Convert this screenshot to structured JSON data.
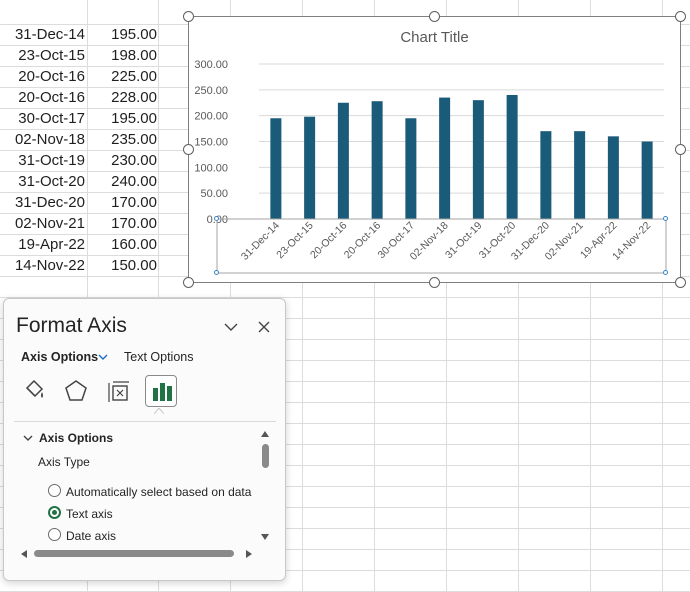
{
  "table": {
    "rows": [
      {
        "date": "31-Dec-14",
        "value": "195.00"
      },
      {
        "date": "23-Oct-15",
        "value": "198.00"
      },
      {
        "date": "20-Oct-16",
        "value": "225.00"
      },
      {
        "date": "20-Oct-16",
        "value": "228.00"
      },
      {
        "date": "30-Oct-17",
        "value": "195.00"
      },
      {
        "date": "02-Nov-18",
        "value": "235.00"
      },
      {
        "date": "31-Oct-19",
        "value": "230.00"
      },
      {
        "date": "31-Oct-20",
        "value": "240.00"
      },
      {
        "date": "31-Dec-20",
        "value": "170.00"
      },
      {
        "date": "02-Nov-21",
        "value": "170.00"
      },
      {
        "date": "19-Apr-22",
        "value": "160.00"
      },
      {
        "date": "14-Nov-22",
        "value": "150.00"
      }
    ]
  },
  "chart_data": {
    "type": "bar",
    "title": "Chart Title",
    "categories": [
      "31-Dec-14",
      "23-Oct-15",
      "20-Oct-16",
      "20-Oct-16",
      "30-Oct-17",
      "02-Nov-18",
      "31-Oct-19",
      "31-Oct-20",
      "31-Dec-20",
      "02-Nov-21",
      "19-Apr-22",
      "14-Nov-22"
    ],
    "values": [
      195,
      198,
      225,
      228,
      195,
      235,
      230,
      240,
      170,
      170,
      160,
      150
    ],
    "ylim": [
      0,
      300
    ],
    "yticks": [
      "0.00",
      "50.00",
      "100.00",
      "150.00",
      "200.00",
      "250.00",
      "300.00"
    ],
    "grid": true,
    "bar_color": "#1b5b7a",
    "gridline_color": "#d9d9d9"
  },
  "panel": {
    "title": "Format Axis",
    "tab_axis_options": "Axis Options",
    "tab_text_options": "Text Options",
    "section_title": "Axis Options",
    "axis_type_label": "Axis Type",
    "opt_auto_pre": "Automatically select based on data",
    "opt_text_pre": "Text axis",
    "opt_date_pre": "Date axis",
    "icons": [
      "fill-line-icon",
      "effects-icon",
      "size-properties-icon",
      "axis-options-icon"
    ],
    "accent_color": "#217346"
  }
}
